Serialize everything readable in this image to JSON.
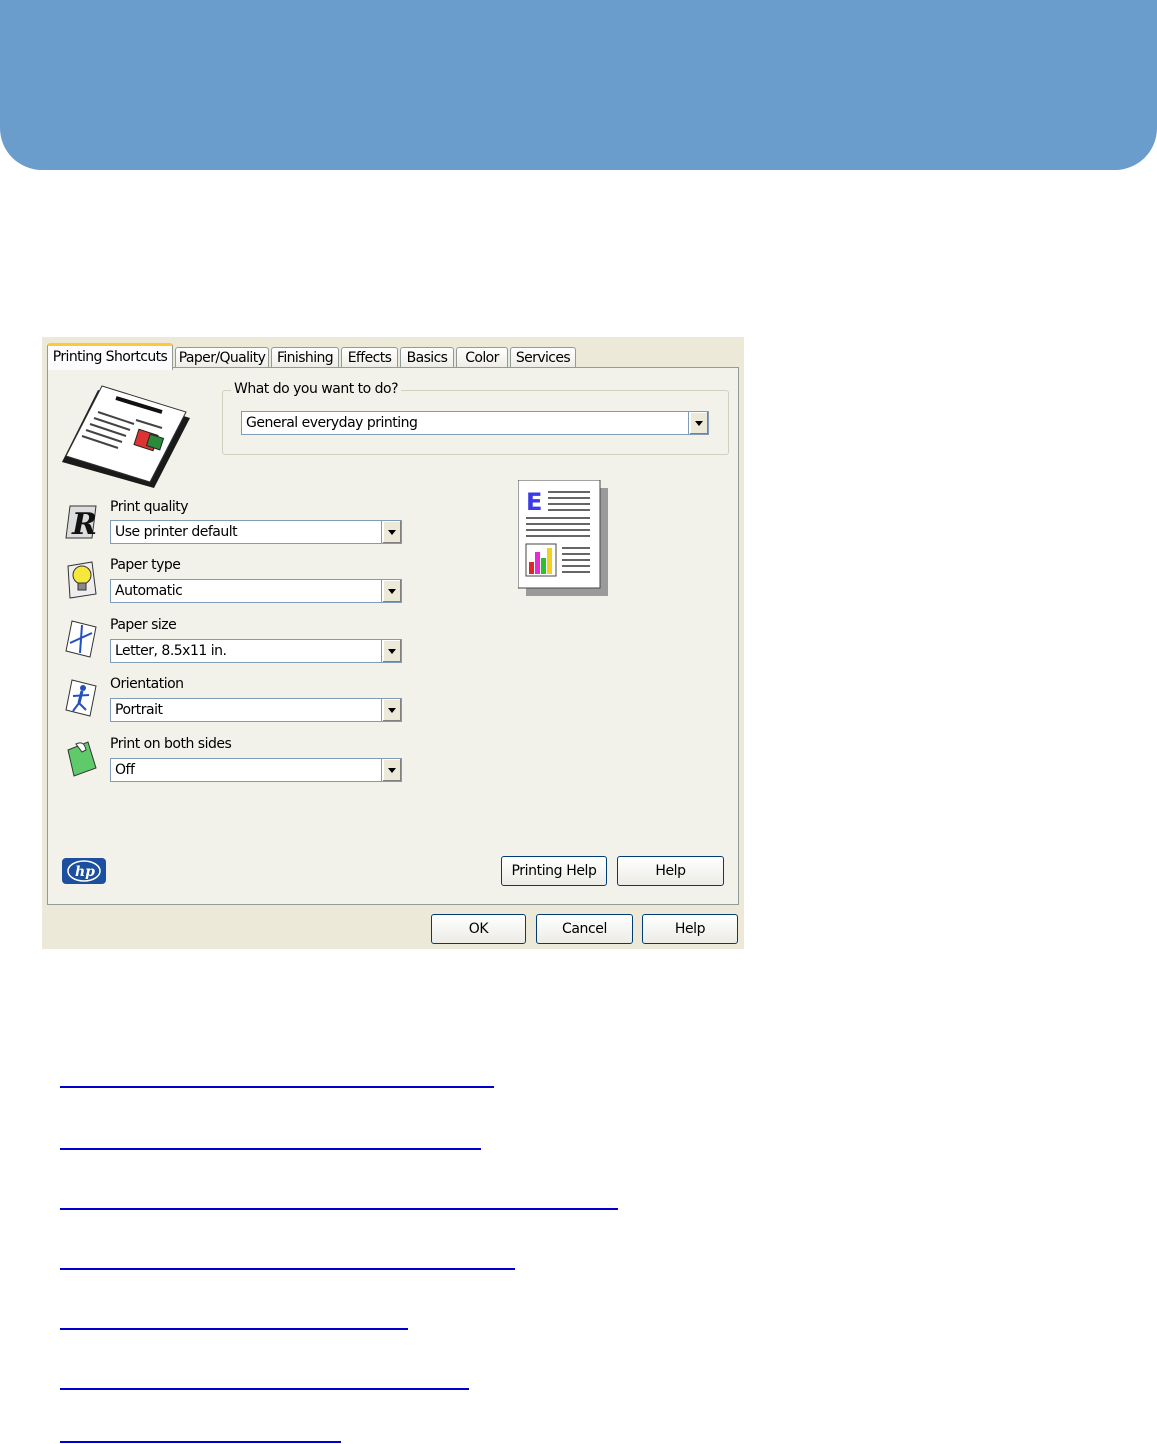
{
  "dialog": {
    "tabs": [
      {
        "label": "Printing Shortcuts",
        "active": true
      },
      {
        "label": "Paper/Quality"
      },
      {
        "label": "Finishing"
      },
      {
        "label": "Effects"
      },
      {
        "label": "Basics"
      },
      {
        "label": "Color"
      },
      {
        "label": "Services"
      }
    ],
    "task_group": {
      "label": "What do you want to do?",
      "value": "General everyday printing"
    },
    "settings": [
      {
        "label": "Print quality",
        "value": "Use printer default",
        "icon": "print-quality-icon"
      },
      {
        "label": "Paper type",
        "value": "Automatic",
        "icon": "lightbulb-icon"
      },
      {
        "label": "Paper size",
        "value": "Letter, 8.5x11 in.",
        "icon": "paper-size-icon"
      },
      {
        "label": "Orientation",
        "value": "Portrait",
        "icon": "orientation-icon"
      },
      {
        "label": "Print on both sides",
        "value": "Off",
        "icon": "duplex-icon"
      }
    ],
    "buttons": {
      "printing_help": "Printing Help",
      "help_inner": "Help",
      "ok": "OK",
      "cancel": "Cancel",
      "help": "Help"
    },
    "logo_text": "hp"
  },
  "colors": {
    "banner": "#6a9ccc",
    "link": "#0000cc",
    "dialog_bg": "#ece9d8"
  }
}
